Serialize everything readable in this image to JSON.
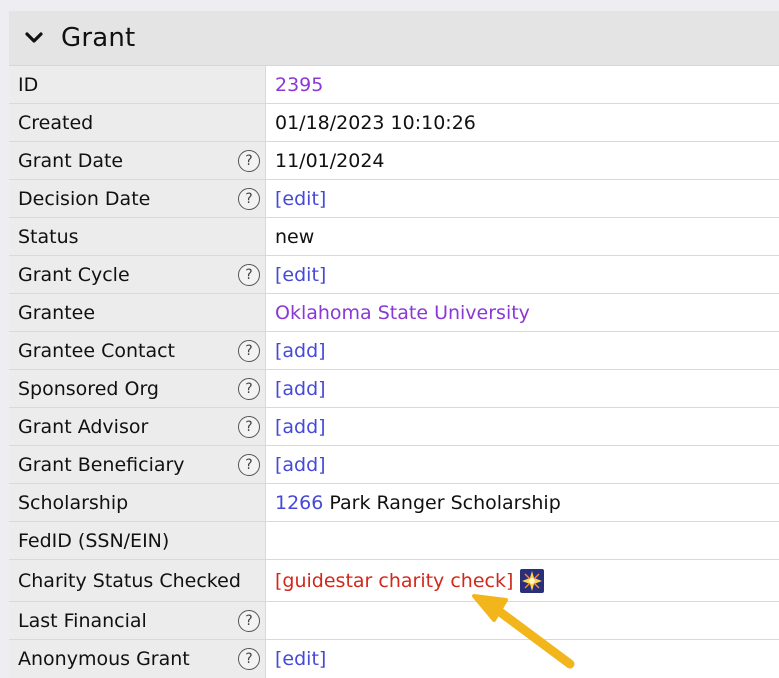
{
  "panel": {
    "title": "Grant"
  },
  "rows": [
    {
      "label": "ID",
      "value": "2395"
    },
    {
      "label": "Created",
      "value": "01/18/2023 10:10:26"
    },
    {
      "label": "Grant Date",
      "value": "11/01/2024"
    },
    {
      "label": "Decision Date",
      "value": "[edit]"
    },
    {
      "label": "Status",
      "value": "new"
    },
    {
      "label": "Grant Cycle",
      "value": "[edit]"
    },
    {
      "label": "Grantee",
      "value": "Oklahoma State University"
    },
    {
      "label": "Grantee Contact",
      "value": "[add]"
    },
    {
      "label": "Sponsored Org",
      "value": "[add]"
    },
    {
      "label": "Grant Advisor",
      "value": "[add]"
    },
    {
      "label": "Grant Beneficiary",
      "value": "[add]"
    },
    {
      "label": "Scholarship",
      "value_id": "1266",
      "value_text": " Park Ranger Scholarship"
    },
    {
      "label": "FedID (SSN/EIN)",
      "value": ""
    },
    {
      "label": "Charity Status Checked",
      "value": "[guidestar charity check]"
    },
    {
      "label": "Last Financial",
      "value": ""
    },
    {
      "label": "Anonymous Grant",
      "value": "[edit]"
    }
  ],
  "help_glyph": "?",
  "icons": {
    "toggle": "chevron-down-icon",
    "help": "help-circle-icon",
    "sparkle": "sparkle-icon",
    "annotation": "arrow-annotation"
  },
  "colors": {
    "link_purple": "#8a38d6",
    "link_blue": "#4549d8",
    "link_red": "#d2281c",
    "arrow": "#f2b51b"
  }
}
